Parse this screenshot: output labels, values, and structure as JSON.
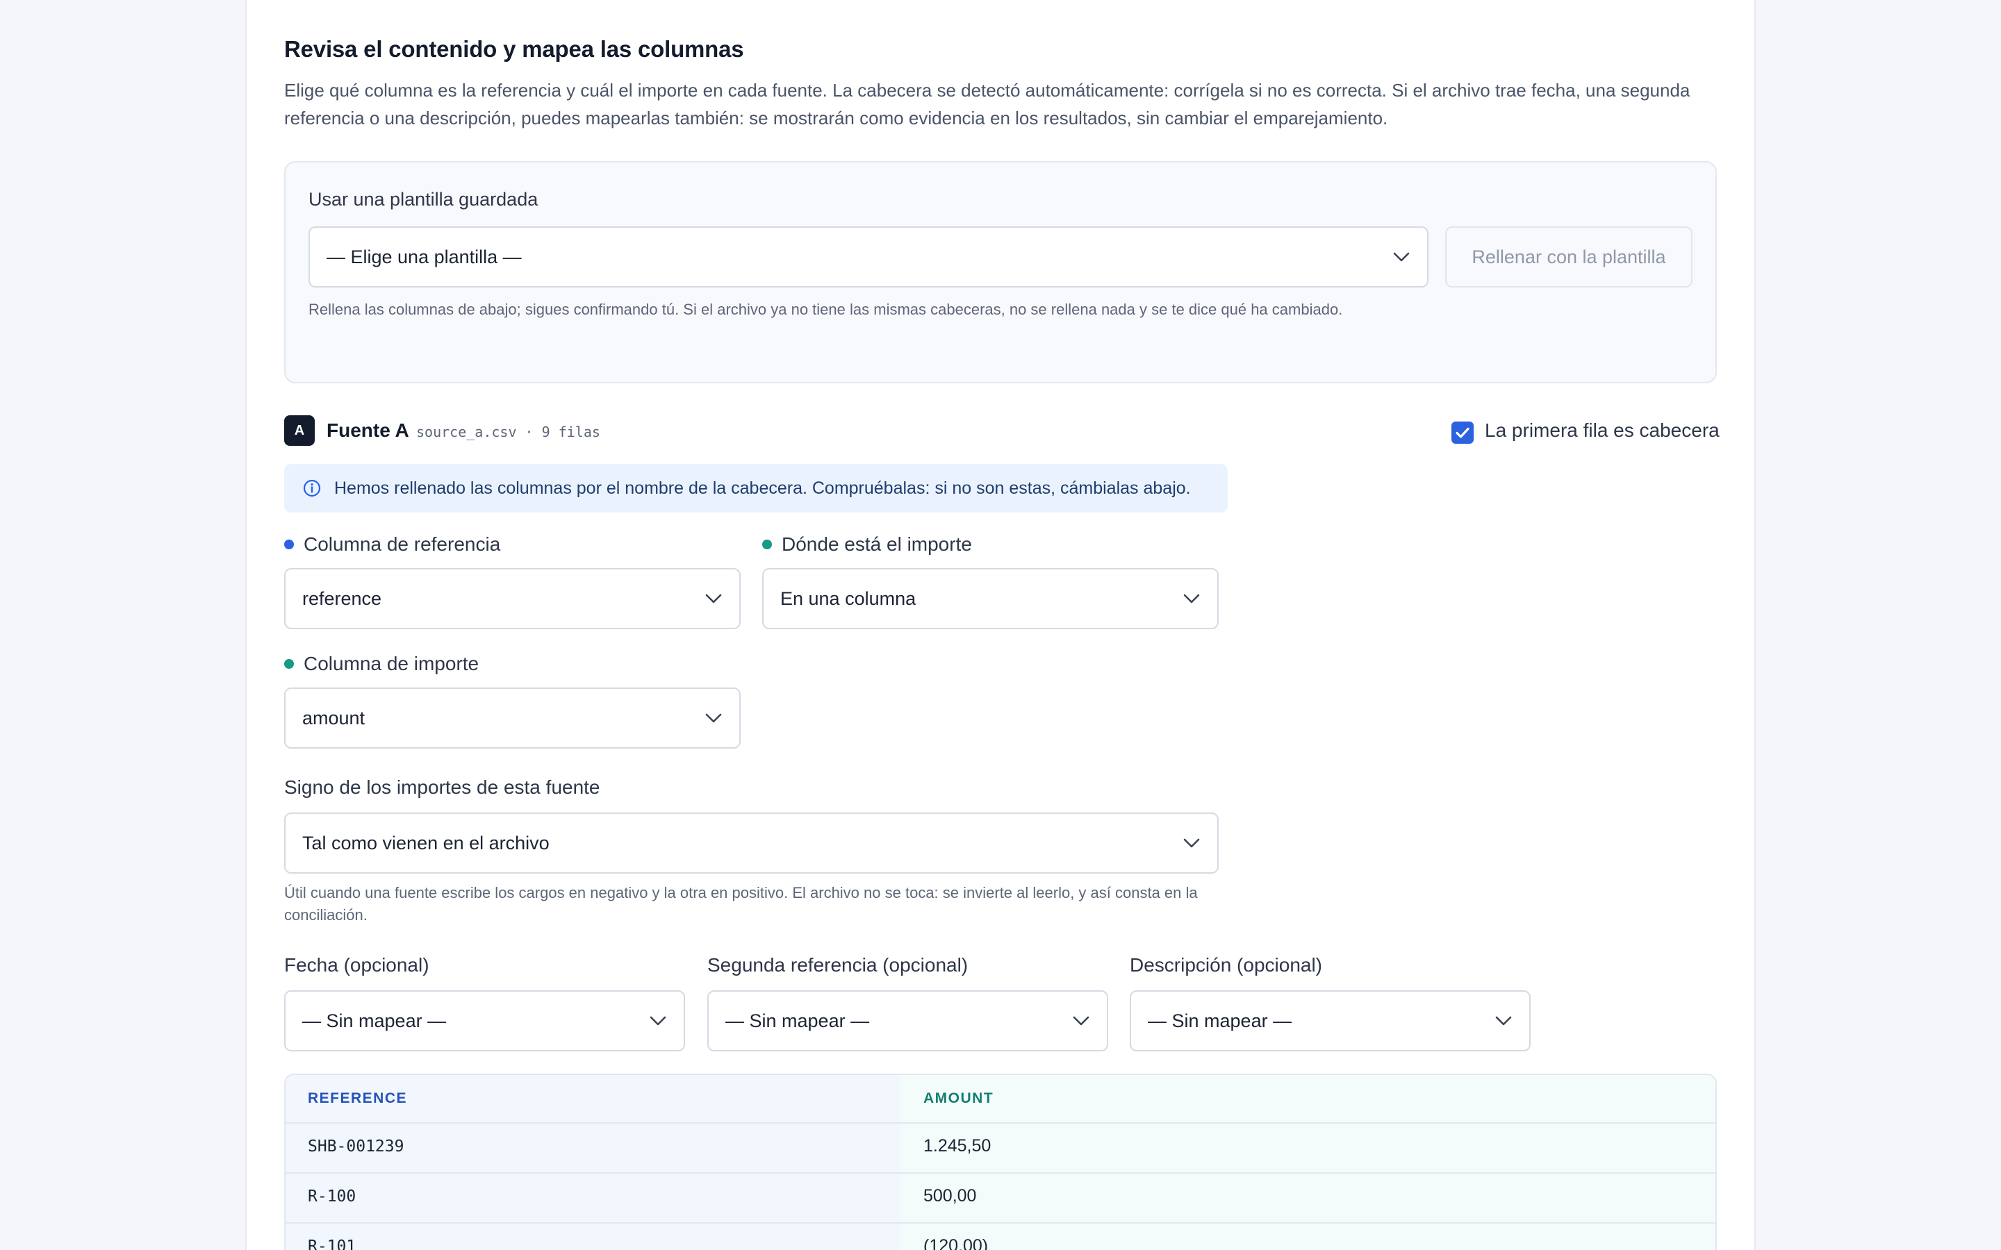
{
  "section": {
    "title": "Revisa el contenido y mapea las columnas",
    "description": "Elige qué columna es la referencia y cuál el importe en cada fuente. La cabecera se detectó automáticamente: corrígela si no es correcta. Si el archivo trae fecha, una segunda referencia o una descripción, puedes mapearlas también: se mostrarán como evidencia en los resultados, sin cambiar el emparejamiento."
  },
  "template": {
    "label": "Usar una plantilla guardada",
    "select_value": "— Elige una plantilla —",
    "apply_button": "Rellenar con la plantilla",
    "hint": "Rellena las columnas de abajo; sigues confirmando tú. Si el archivo ya no tiene las mismas cabeceras, no se rellena nada y se te dice qué ha cambiado."
  },
  "source": {
    "badge": "A",
    "name": "Fuente A",
    "meta": "source_a.csv · 9 filas",
    "header_checkbox_label": "La primera fila es cabecera",
    "header_checked": true,
    "info_message": "Hemos rellenado las columnas por el nombre de la cabecera. Compruébalas: si no son estas, cámbialas abajo."
  },
  "mapping": {
    "reference_label": "Columna de referencia",
    "reference_value": "reference",
    "amount_location_label": "Dónde está el importe",
    "amount_location_value": "En una columna",
    "amount_label": "Columna de importe",
    "amount_value": "amount",
    "sign_label": "Signo de los importes de esta fuente",
    "sign_value": "Tal como vienen en el archivo",
    "sign_hint": "Útil cuando una fuente escribe los cargos en negativo y la otra en positivo. El archivo no se toca: se invierte al leerlo, y así consta en la conciliación.",
    "date_label": "Fecha (opcional)",
    "date_value": "— Sin mapear —",
    "second_ref_label": "Segunda referencia (opcional)",
    "second_ref_value": "— Sin mapear —",
    "description_label": "Descripción (opcional)",
    "description_value": "— Sin mapear —"
  },
  "preview": {
    "columns": [
      "REFERENCE",
      "AMOUNT"
    ],
    "rows": [
      [
        "SHB-001239",
        "1.245,50"
      ],
      [
        "R-100",
        "500,00"
      ],
      [
        "R-101",
        "(120,00)"
      ]
    ]
  },
  "colors": {
    "reference_accent": "#2a62e0",
    "amount_accent": "#159a86",
    "checkbox": "#2a62e0"
  }
}
